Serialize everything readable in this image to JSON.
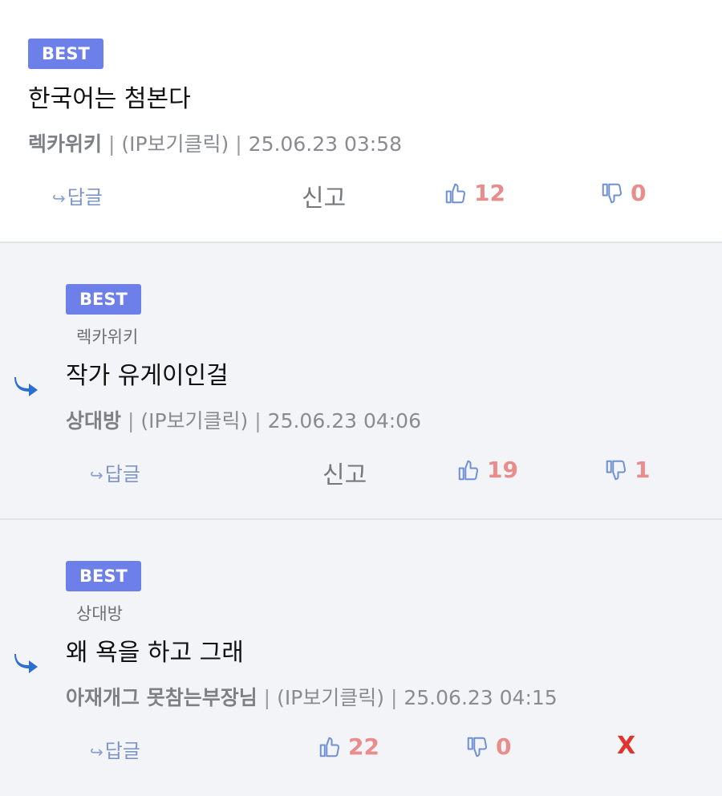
{
  "comments": [
    {
      "badge": "BEST",
      "text": "한국어는 첨본다",
      "author": "렉카위키",
      "ip_label": "(IP보기클릭)",
      "sep": "|",
      "date": "25.06.23 03:58",
      "reply_label": "답글",
      "report_label": "신고",
      "likes": "12",
      "dislikes": "0"
    },
    {
      "badge": "BEST",
      "parent": "렉카위키",
      "text": "작가 유게이인걸",
      "author": "상대방",
      "ip_label": "(IP보기클릭)",
      "sep": "|",
      "date": "25.06.23 04:06",
      "reply_label": "답글",
      "report_label": "신고",
      "likes": "19",
      "dislikes": "1"
    },
    {
      "badge": "BEST",
      "parent": "상대방",
      "text": "왜 욕을 하고 그래",
      "author": "아재개그 못참는부장님",
      "ip_label": "(IP보기클릭)",
      "sep": "|",
      "date": "25.06.23 04:15",
      "reply_label": "답글",
      "likes": "22",
      "dislikes": "0",
      "delete_label": "X"
    }
  ],
  "icons": {
    "reply_arrow": "reply-arrow-icon",
    "like": "thumbs-up-icon",
    "dislike": "thumbs-down-icon"
  },
  "colors": {
    "badge": "#6d7fe8",
    "vote_count": "#e98c8c",
    "icon_blue": "#6e8fd6",
    "reply_arrow": "#2b6fd1",
    "delete": "#e0342f"
  }
}
